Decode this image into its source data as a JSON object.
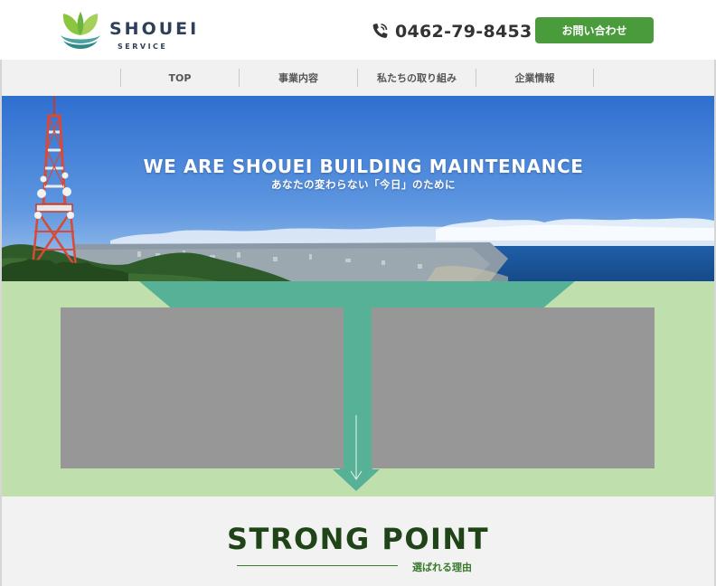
{
  "header": {
    "logo_name": "SHOUEI",
    "logo_sub": "SERVICE",
    "logo_icon": "leaf-hands-logo",
    "phone_icon": "phone-icon",
    "phone_number": "0462-79-8453",
    "contact_label": "お問い合わせ",
    "accent_color": "#4a9b3c"
  },
  "nav": {
    "items": [
      {
        "label": "TOP"
      },
      {
        "label": "事業内容"
      },
      {
        "label": "私たちの取り組み"
      },
      {
        "label": "企業情報"
      }
    ]
  },
  "hero": {
    "title": "WE ARE SHOUEI BUILDING MAINTENANCE",
    "subtitle": "あなたの変わらない「今日」のために"
  },
  "features": {
    "colors": {
      "background": "#bfe0ad",
      "arrow": "#56b197",
      "card": "#979797"
    }
  },
  "strong_point": {
    "title": "STRONG POINT",
    "subtitle": "選ばれる理由"
  }
}
